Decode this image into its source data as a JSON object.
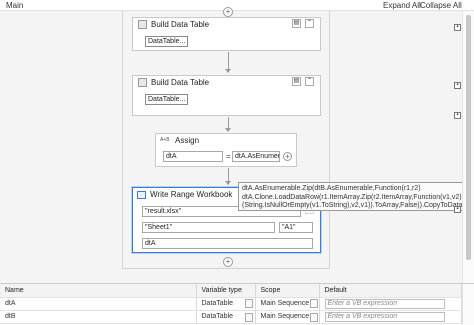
{
  "header": {
    "title": "Main",
    "expand_all": "Expand All",
    "collapse_all": "Collapse All"
  },
  "activities": [
    {
      "title": "Build Data Table",
      "button": "DataTable..."
    },
    {
      "title": "Build Data Table",
      "button": "DataTable..."
    }
  ],
  "assign": {
    "title": "Assign",
    "icon_text": "A+B",
    "to": "dtA",
    "equals": "=",
    "value": "dtA.AsEnumer..."
  },
  "tooltip": {
    "lines": [
      "dtA.AsEnumerable.Zip(dtB.AsEnumerable,Function(r1,r2)",
      "dtA.Clone.LoadDataRow(r1.ItemArray.Zip(r2.ItemArray,Function(v1,v2) if",
      "(String.IsNullOrEmpty(v1.ToString),v2,v1)).ToArray,False)).CopyToDataTable"
    ]
  },
  "write_range": {
    "title": "Write Range Workbook",
    "workbook_path": "\"result.xlsx\"",
    "sheet": "\"Sheet1\"",
    "start_cell": "\"A1\"",
    "datatable": "dtA"
  },
  "variables": {
    "columns": [
      "Name",
      "Variable type",
      "Scope",
      "Default"
    ],
    "rows": [
      {
        "name": "dtA",
        "type": "DataTable",
        "scope": "Main Sequence",
        "default_placeholder": "Enter a VB expression"
      },
      {
        "name": "dtB",
        "type": "DataTable",
        "scope": "Main Sequence",
        "default_placeholder": "Enter a VB expression"
      }
    ]
  },
  "icons": [
    "collapse-icon",
    "drag-handle-icon",
    "folder-icon",
    "plus-icon",
    "dropdown-icon"
  ],
  "colors": {
    "selection": "#3a7bd5",
    "canvas": "#f4f4f4"
  }
}
